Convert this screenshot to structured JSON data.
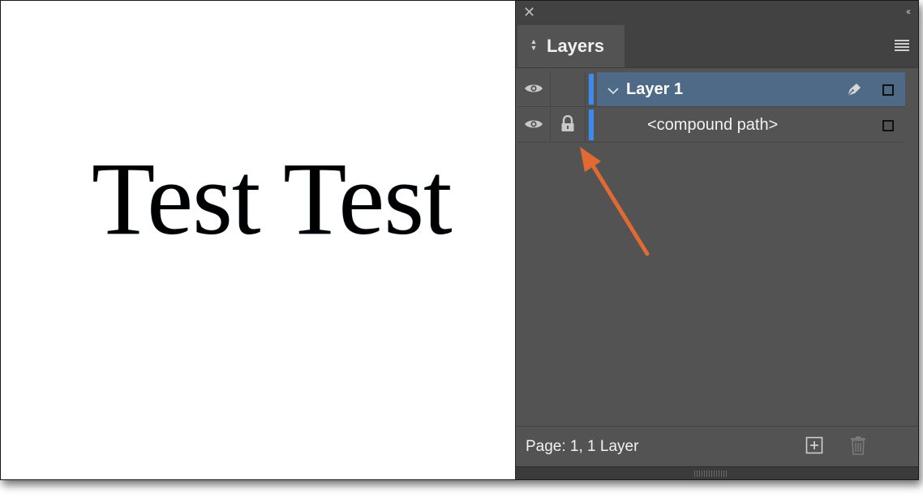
{
  "canvas": {
    "text": "Test Test"
  },
  "panel": {
    "close_glyph": "✕",
    "collapse_glyph": "‹‹",
    "tab": {
      "label": "Layers",
      "icon": "double-chevron-updown-icon"
    },
    "menu_icon": "panel-menu-icon",
    "layers": [
      {
        "label": "Layer 1",
        "expanded": true,
        "selected": true,
        "visible": true,
        "locked": false,
        "color": "#3d8bf0",
        "icons": [
          "eye-icon",
          "chevron-down-icon",
          "pen-icon",
          "selection-square-icon"
        ]
      },
      {
        "label": "<compound path>",
        "child": true,
        "visible": true,
        "locked": true,
        "color": "#3d8bf0",
        "icons": [
          "eye-icon",
          "lock-icon",
          "selection-square-icon"
        ]
      }
    ],
    "footer": {
      "status": "Page: 1, 1 Layer",
      "icons": [
        "add-layer-icon",
        "trash-icon"
      ]
    }
  },
  "annotation": {
    "type": "arrow",
    "color": "#e06a32",
    "icon": "annotation-arrow"
  },
  "colors": {
    "panel_bg": "#535353",
    "panel_header": "#424242",
    "selected_row": "#4f6a86",
    "layer_color": "#3d8bf0",
    "arrow": "#e06a32"
  }
}
